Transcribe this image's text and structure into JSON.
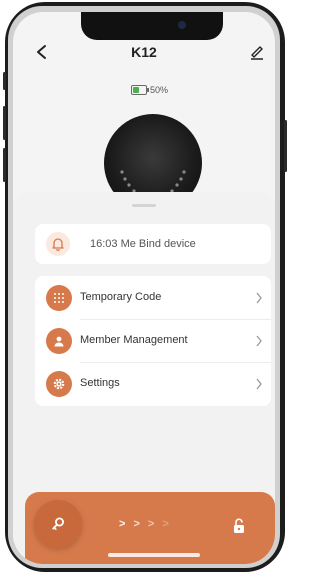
{
  "header": {
    "title": "K12"
  },
  "battery": {
    "level_text": "50%",
    "level": 0.5,
    "fill_color": "#4caf50"
  },
  "activity": {
    "text": "16:03 Me  Bind device",
    "icon": "bell-icon"
  },
  "menu": {
    "items": [
      {
        "label": "Temporary Code",
        "icon": "keypad-icon"
      },
      {
        "label": "Member Management",
        "icon": "person-icon"
      },
      {
        "label": "Settings",
        "icon": "gear-icon"
      }
    ]
  },
  "bottom_bar": {
    "key_icon": "key-icon",
    "unlock_icon": "unlock-icon",
    "arrows": [
      ">",
      ">",
      ">",
      ">"
    ]
  },
  "colors": {
    "accent": "#d77a4b",
    "accent_light": "#fbe8df",
    "background": "#f4f4f4"
  }
}
